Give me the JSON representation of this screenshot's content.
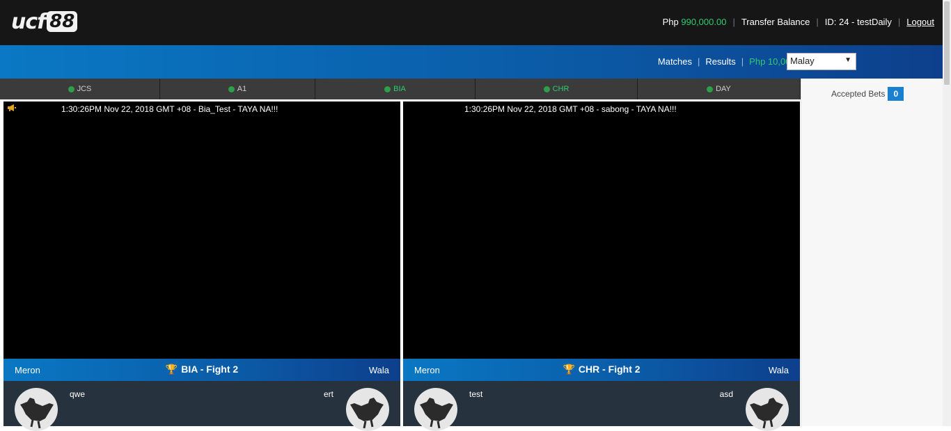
{
  "header": {
    "logo_text": "ucf",
    "logo_number": "88",
    "currency": "Php",
    "balance": "990,000.00",
    "transfer_label": "Transfer Balance",
    "id_label": "ID: 24 - testDaily",
    "logout_label": "Logout"
  },
  "nav": {
    "matches_label": "Matches",
    "results_label": "Results",
    "php_amount": "Php 10,000.00",
    "username": "testDaily",
    "language": "Malay"
  },
  "tabs": [
    {
      "label": "JCS",
      "status": "live"
    },
    {
      "label": "A1",
      "status": "live"
    },
    {
      "label": "BIA",
      "status": "live"
    },
    {
      "label": "CHR",
      "status": "live"
    },
    {
      "label": "DAY",
      "status": "live"
    }
  ],
  "sidebar": {
    "accepted_bets_label": "Accepted Bets",
    "accepted_bets_count": "0"
  },
  "panels": [
    {
      "ticker": "1:30:26PM Nov 22, 2018 GMT +08 - Bia_Test - TAYA NA!!!",
      "meron_label": "Meron",
      "wala_label": "Wala",
      "fight_title": "BIA - Fight 2",
      "meron_fighter": "qwe",
      "wala_fighter": "ert"
    },
    {
      "ticker": "1:30:26PM Nov 22, 2018 GMT +08 - sabong - TAYA NA!!!",
      "meron_label": "Meron",
      "wala_label": "Wala",
      "fight_title": "CHR - Fight 2",
      "meron_fighter": "test",
      "wala_fighter": "asd"
    }
  ],
  "colors": {
    "accent_blue": "#0a78c4",
    "money_green": "#2ecc71",
    "header_bg": "#161616",
    "status_dot": "#2e9e4a"
  },
  "icons": {
    "announcement": "megaphone-icon",
    "fight_title": "trophy-icon",
    "fighter_avatar": "rooster-icon",
    "dropdown": "caret-down-icon"
  }
}
